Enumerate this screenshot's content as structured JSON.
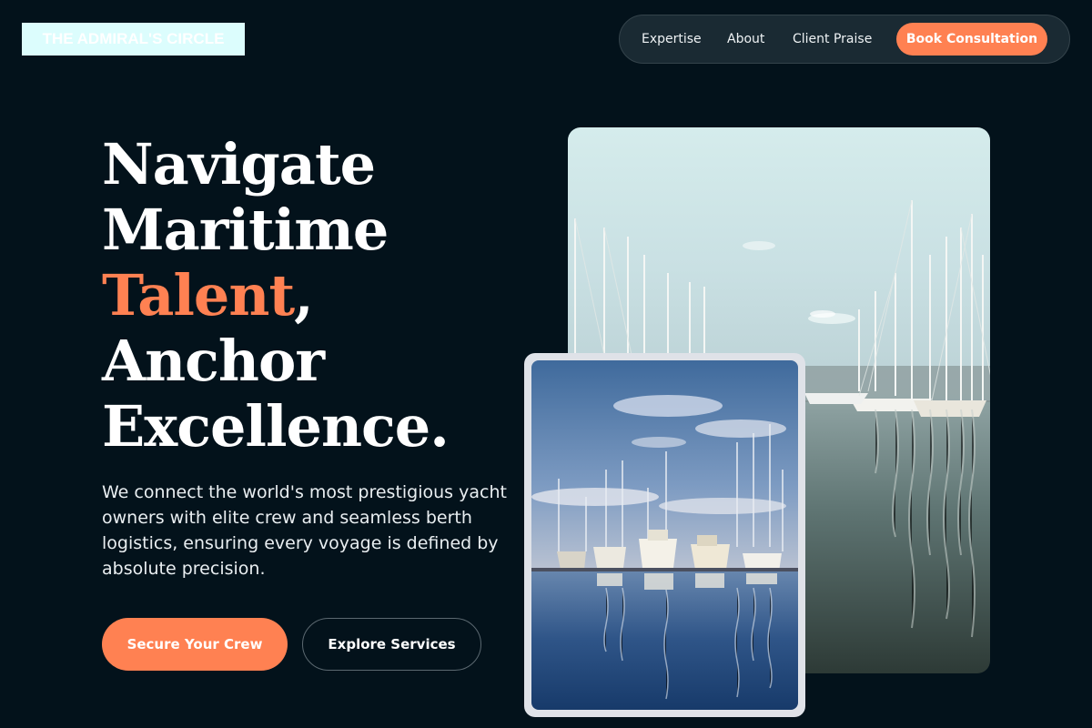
{
  "brand": {
    "logo_text": "THE ADMIRAL'S CIRCLE"
  },
  "nav": {
    "links": [
      "Expertise",
      "About",
      "Client Praise"
    ],
    "cta_label": "Book Consultation"
  },
  "hero": {
    "headline": {
      "line1": "Navigate",
      "line2": "Maritime",
      "line3_accent": "Talent",
      "line3_rest": ",",
      "line4": "Anchor",
      "line5": "Excellence."
    },
    "intro": "We connect the world's most prestigious yacht owners with elite crew and seamless berth logistics, ensuring every voyage is defined by absolute precision.",
    "primary_button": "Secure Your Crew",
    "secondary_button": "Explore Services"
  },
  "colors": {
    "background": "#03121b",
    "accent": "#ff8152",
    "nav_background": "#1a2a33",
    "logo_background": "#dcfdfd"
  },
  "images": {
    "large": "marina-sailboat-masts-photo",
    "small": "marina-yachts-reflection-photo"
  }
}
